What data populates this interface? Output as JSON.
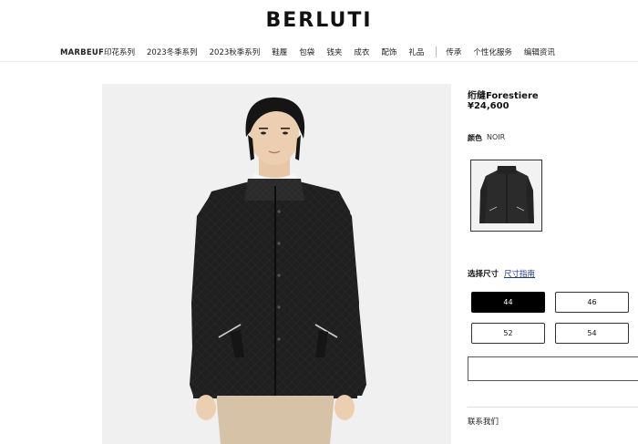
{
  "brand": {
    "logo_text": "BERLUTI"
  },
  "nav": {
    "brand_item_bold": "MARBEUF",
    "brand_item_rest": "印花系列",
    "items": [
      "2023冬季系列",
      "2023秋季系列",
      "鞋履",
      "包袋",
      "钱夹",
      "成衣",
      "配饰",
      "礼品"
    ],
    "items_after_sep": [
      "传承",
      "个性化服务",
      "编辑资讯"
    ]
  },
  "product": {
    "name": "绗缝Forestiere",
    "price": "¥24,600",
    "color_label": "颜色",
    "color_value": "NOIR",
    "size_label": "选择尺寸",
    "size_guide": "尺寸指南",
    "sizes": [
      {
        "label": "44",
        "selected": true
      },
      {
        "label": "46",
        "selected": false
      },
      {
        "label": "52",
        "selected": false
      },
      {
        "label": "54",
        "selected": false
      }
    ],
    "primary_cta_label": ""
  },
  "footer_links": {
    "contact": "联系我们"
  },
  "colors": {
    "accent": "#000000",
    "hero_bg": "#f0f0f0",
    "jacket": "#1d1d1d",
    "link": "#1e3a8a"
  }
}
